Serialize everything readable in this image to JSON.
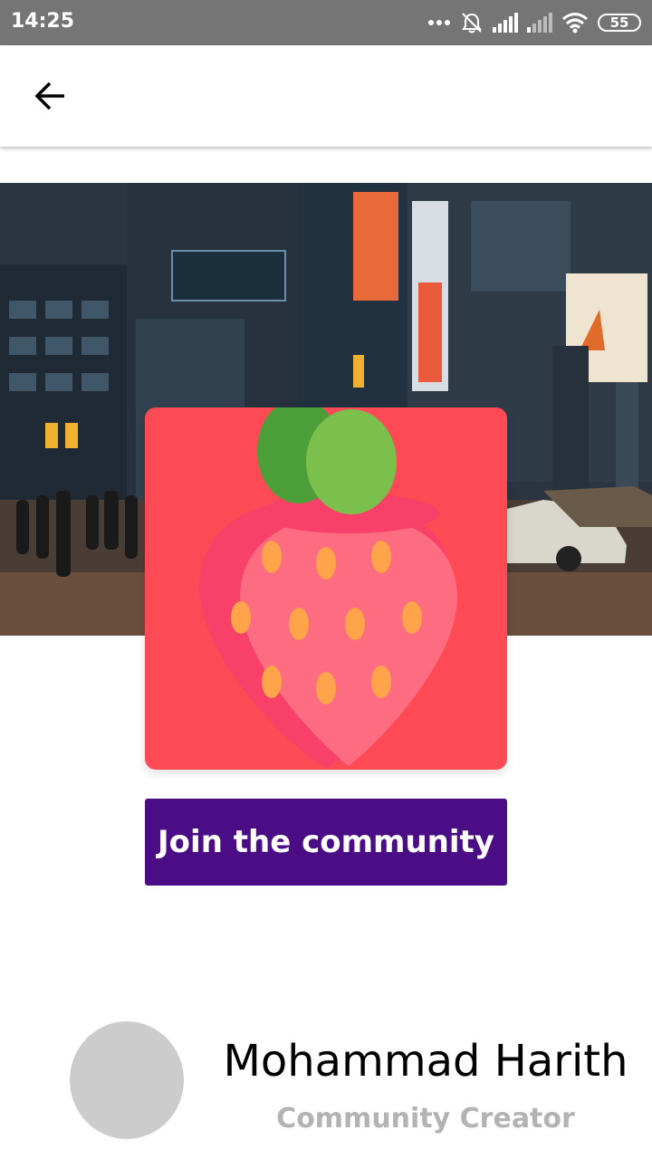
{
  "status_bar": {
    "time": "14:25",
    "battery": "55",
    "icons": [
      "more-dots-icon",
      "alarm-off-icon",
      "signal-icon",
      "signal-weak-icon",
      "wifi-icon",
      "battery-icon"
    ]
  },
  "app_bar": {
    "back_icon": "arrow-back-icon"
  },
  "community": {
    "logo_icon": "strawberry-icon",
    "join_label": "Join the community"
  },
  "creator": {
    "name": "Mohammad Harith",
    "role": "Community Creator"
  },
  "colors": {
    "status_bar": "#757575",
    "logo_background": "#fe4a55",
    "join_button": "#4a0d86",
    "avatar_placeholder": "#cccccc",
    "role_text": "#b3b3b3"
  }
}
